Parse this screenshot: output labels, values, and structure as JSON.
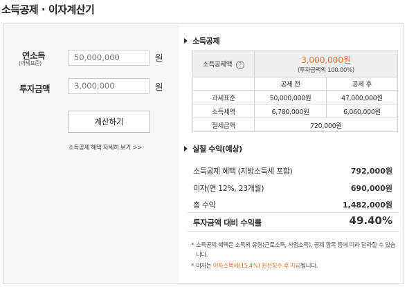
{
  "title": "소득공제 · 이자계산기",
  "form": {
    "income_label": "연소득",
    "income_sub": "(과세표준)",
    "income_value": "50,000,000",
    "invest_label": "투자금액",
    "invest_value": "3,000,000",
    "unit": "원",
    "calc_button": "계산하기",
    "detail_link": "소득공제 혜택 자세히 보기 >>"
  },
  "deduction": {
    "section_title": "소득공제",
    "amount_label": "소득공제액",
    "help_icon": "?",
    "amount_value": "3,000,000원",
    "amount_note": "(투자금액의 100.00%)",
    "col_before": "공제 전",
    "col_after": "공제 후",
    "rows": [
      {
        "label": "과세표준",
        "before": "50,000,000원",
        "after": "47,000,000원"
      },
      {
        "label": "소득세액",
        "before": "6,780,000원",
        "after": "6,060,000원"
      }
    ],
    "saving_label": "절세금액",
    "saving_value": "720,000원"
  },
  "returns": {
    "section_title": "실질 수익(예상)",
    "rows": [
      {
        "label": "소득공제 혜택 (지방소득세 포함)",
        "value": "792,000원"
      },
      {
        "label": "이자(연 12%, 23개월)",
        "value": "690,000원"
      },
      {
        "label": "총 수익",
        "value": "1,482,000원"
      }
    ],
    "ratio_label": "투자금액 대비 수익률",
    "ratio_value": "49.40%"
  },
  "notes": {
    "star": "*",
    "note1": "소득공제 혜택은 소득의 유형(근로소득, 사업소득), 공제 항목 등에 따라 달라질 수 있습니다.",
    "note2_pre": "이자는 ",
    "note2_highlight": "이자소득세(15.4%) 원천징수 후 지급",
    "note2_post": "됩니다."
  },
  "colors": {
    "accent": "#e8782e",
    "panel_left_bg": "#f7f7f7",
    "table_header_bg": "#efefef"
  }
}
